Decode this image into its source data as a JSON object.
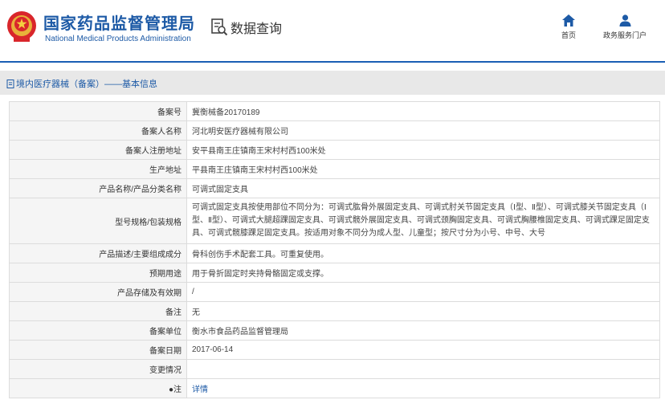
{
  "header": {
    "org_name_cn": "国家药品监督管理局",
    "org_name_en": "National Medical Products Administration",
    "query_label": "数据查询",
    "nav": [
      {
        "label": "首页",
        "icon": "home-icon"
      },
      {
        "label": "政务服务门户",
        "icon": "user-icon"
      }
    ]
  },
  "breadcrumb": {
    "text": "境内医疗器械（备案）——基本信息",
    "icon": "document-icon"
  },
  "colors": {
    "brand_blue": "#1d5aa6",
    "header_rule": "#1a5fb4",
    "label_bg": "#f5f5f5"
  },
  "record": [
    {
      "label": "备案号",
      "value": "冀衡械备20170189"
    },
    {
      "label": "备案人名称",
      "value": "河北明安医疗器械有限公司"
    },
    {
      "label": "备案人注册地址",
      "value": "安平县南王庄镇南王宋村村西100米处"
    },
    {
      "label": "生产地址",
      "value": "平县南王庄镇南王宋村村西100米处"
    },
    {
      "label": "产品名称/产品分类名称",
      "value": "可调式固定支具"
    },
    {
      "label": "型号规格/包装规格",
      "value": "可调式固定支具按使用部位不同分为：可调式肱骨外展固定支具、可调式肘关节固定支具（Ⅰ型、Ⅱ型）、可调式膝关节固定支具（Ⅰ型、Ⅱ型）、可调式大腿超踝固定支具、可调式髋外展固定支具、可调式颈胸固定支具、可调式胸腰椎固定支具、可调式踝足固定支具、可调式髋膝踝足固定支具。按适用对象不同分为成人型、儿童型；按尺寸分为小号、中号、大号"
    },
    {
      "label": "产品描述/主要组成成分",
      "value": "骨科创伤手术配套工具。可重复使用。"
    },
    {
      "label": "预期用途",
      "value": "用于骨折固定时夹持骨骼固定或支撑。"
    },
    {
      "label": "产品存储及有效期",
      "value": "/"
    },
    {
      "label": "备注",
      "value": "无"
    },
    {
      "label": "备案单位",
      "value": "衡水市食品药品监督管理局"
    },
    {
      "label": "备案日期",
      "value": "2017-06-14"
    },
    {
      "label": "变更情况",
      "value": ""
    },
    {
      "label": "●注",
      "value": "详情"
    }
  ]
}
